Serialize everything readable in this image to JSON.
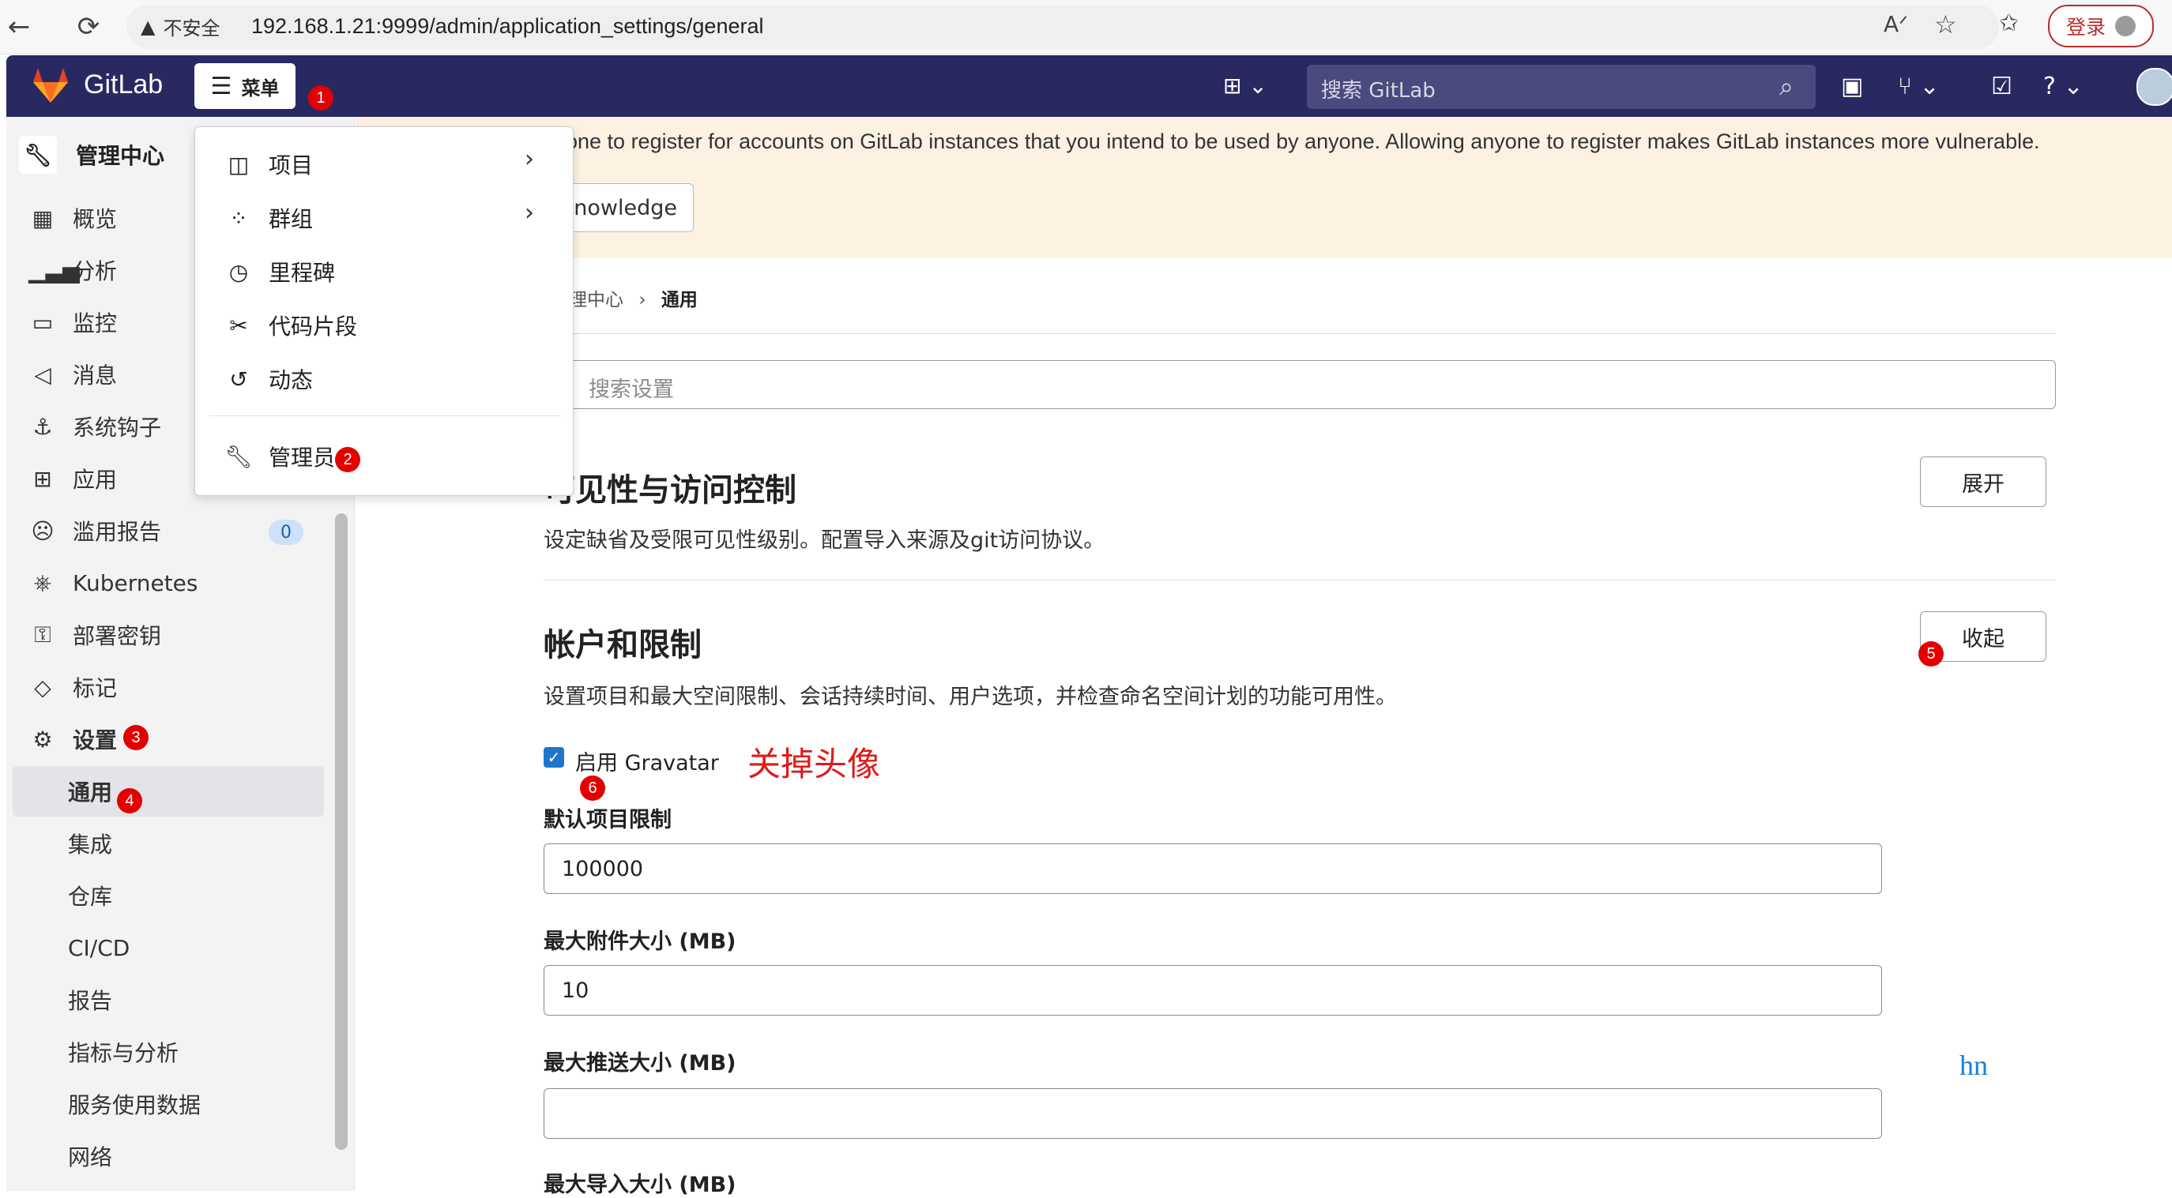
{
  "browser": {
    "security_label": "不安全",
    "url": "192.168.1.21:9999/admin/application_settings/general",
    "login_label": "登录"
  },
  "header": {
    "app_name": "GitLab",
    "menu_label": "菜单",
    "search_placeholder": "搜索 GitLab"
  },
  "markers": [
    "1",
    "2",
    "3",
    "4",
    "5",
    "6"
  ],
  "dropdown": {
    "items": [
      {
        "label": "项目",
        "icon": "project-icon"
      },
      {
        "label": "群组",
        "icon": "group-icon"
      },
      {
        "label": "里程碑",
        "icon": "clock-icon"
      },
      {
        "label": "代码片段",
        "icon": "scissors-icon"
      },
      {
        "label": "动态",
        "icon": "history-icon"
      }
    ],
    "admin_label": "管理员"
  },
  "sidebar": {
    "title": "管理中心",
    "items": [
      {
        "label": "概览",
        "icon": "overview-icon"
      },
      {
        "label": "分析",
        "icon": "chart-icon"
      },
      {
        "label": "监控",
        "icon": "monitor-icon"
      },
      {
        "label": "消息",
        "icon": "megaphone-icon"
      },
      {
        "label": "系统钩子",
        "icon": "anchor-icon"
      },
      {
        "label": "应用",
        "icon": "apps-icon"
      },
      {
        "label": "滥用报告",
        "icon": "abuse-icon"
      },
      {
        "label": "Kubernetes",
        "icon": "kubernetes-icon"
      },
      {
        "label": "部署密钥",
        "icon": "key-icon"
      },
      {
        "label": "标记",
        "icon": "label-icon"
      },
      {
        "label": "设置",
        "icon": "settings-icon"
      }
    ],
    "abuse_count": "0",
    "sub_items": [
      "通用",
      "集成",
      "仓库",
      "CI/CD",
      "报告",
      "指标与分析",
      "服务使用数据",
      "网络"
    ]
  },
  "alert": {
    "text": "one to register for accounts on GitLab instances that you intend to be used by anyone. Allowing anyone to register makes GitLab instances more vulnerable.",
    "button": "knowledge"
  },
  "breadcrumb": {
    "parent": "理中心",
    "separator": "›",
    "current": "通用"
  },
  "search_settings_placeholder": "搜索设置",
  "sections": {
    "visibility": {
      "title": "可见性与访问控制",
      "description": "设定缺省及受限可见性级别。配置导入来源及git访问协议。",
      "button": "展开"
    },
    "account": {
      "title": "帐户和限制",
      "description": "设置项目和最大空间限制、会话持续时间、用户选项，并检查命名空间计划的功能可用性。",
      "button": "收起"
    }
  },
  "form": {
    "gravatar_label": "启用 Gravatar",
    "gravatar_checked": true,
    "fields": [
      {
        "label": "默认项目限制",
        "value": "100000"
      },
      {
        "label": "最大附件大小 (MB)",
        "value": "10"
      },
      {
        "label": "最大推送大小 (MB)",
        "value": ""
      },
      {
        "label": "最大导入大小 (MB)",
        "value": ""
      }
    ]
  },
  "annotation_text": "关掉头像",
  "watermark": "hn",
  "colors": {
    "header_bg": "#292961",
    "alert_bg": "#fdf1e2",
    "marker_red": "#e20000",
    "annotation_red": "#e0191a",
    "checkbox_blue": "#1f75cb"
  }
}
